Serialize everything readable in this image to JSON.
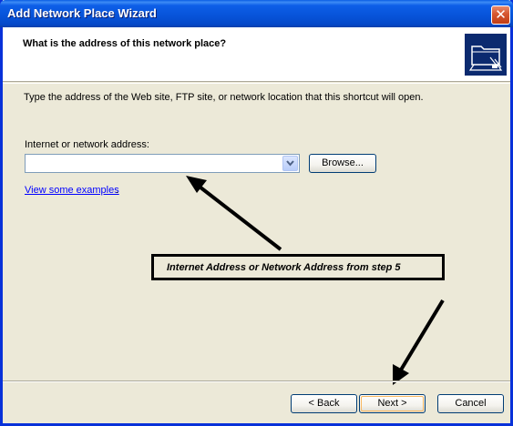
{
  "window": {
    "title": "Add Network Place Wizard",
    "close_glyph": "✕"
  },
  "header": {
    "title": "What is the address of this network place?",
    "icon": "network-folder-icon"
  },
  "body": {
    "instruction": "Type the address of the Web site, FTP site, or network location that this shortcut will open.",
    "address_label": "Internet or network address:",
    "address_value": "",
    "browse_label": "Browse...",
    "examples_link": "View some examples",
    "examples_suffix": "."
  },
  "annotation": {
    "callout_text": "Internet Address or Network Address from step 5"
  },
  "footer": {
    "back_label": "< Back",
    "next_label": "Next >",
    "cancel_label": "Cancel"
  },
  "colors": {
    "titlebar": "#0753d8",
    "dialog_bg": "#ece9d8",
    "link": "#0000ff",
    "close": "#d6562f"
  }
}
